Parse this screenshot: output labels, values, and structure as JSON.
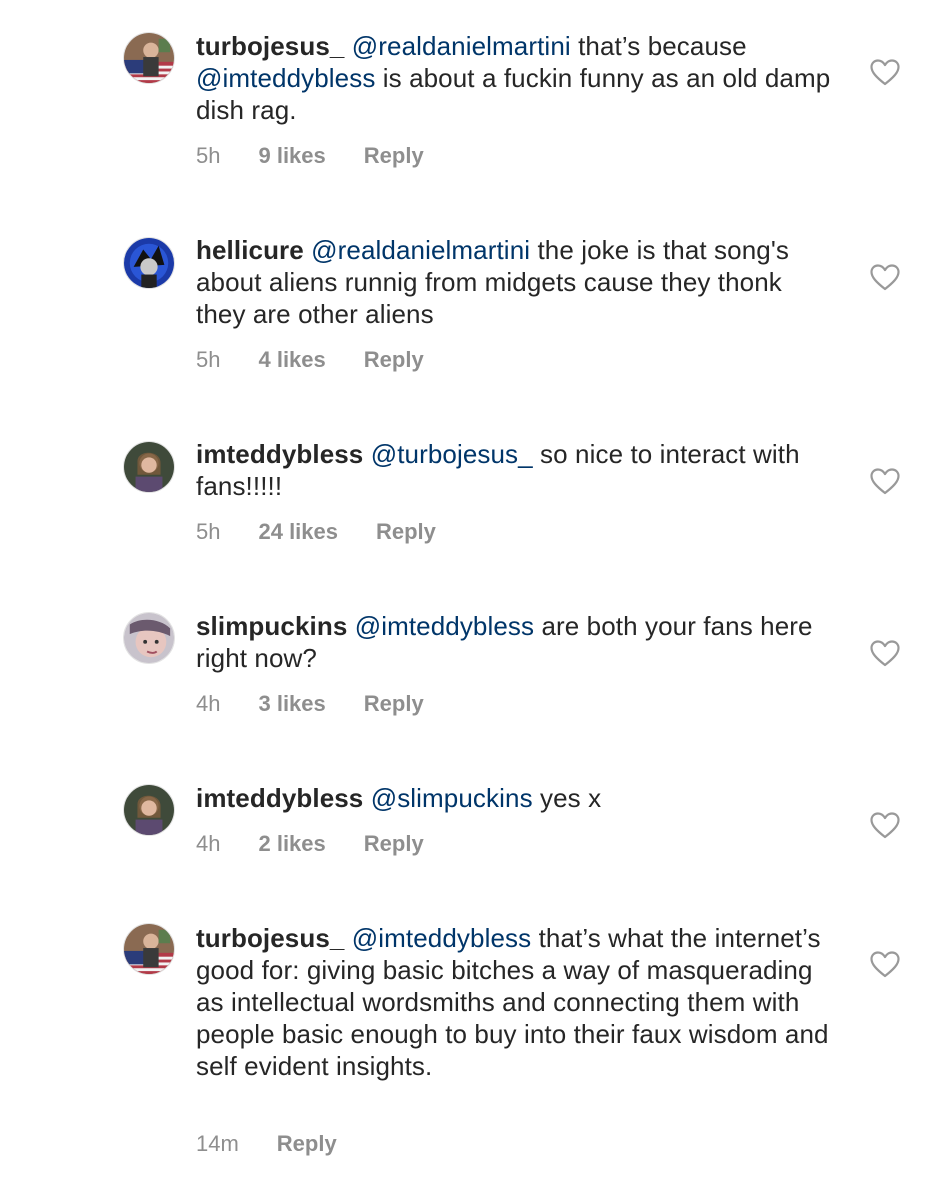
{
  "comments": [
    {
      "username": "turbojesus_",
      "mention": "@realdanielmartini",
      "text": "that’s because",
      "mention2": "@imteddybless",
      "text2": "is about a fuckin funny as an old damp dish rag.",
      "time": "5h",
      "likes": "9 likes",
      "reply": "Reply",
      "avatar_icon": "profile-avatar-flag"
    },
    {
      "username": "hellicure",
      "mention": "@realdanielmartini",
      "text": "the joke is that song's about aliens runnig from midgets cause they thonk they are other aliens",
      "time": "5h",
      "likes": "4 likes",
      "reply": "Reply",
      "avatar_icon": "profile-avatar-blue"
    },
    {
      "username": "imteddybless",
      "mention": "@turbojesus_",
      "text": "so nice to interact with fans!!!!!",
      "time": "5h",
      "likes": "24 likes",
      "reply": "Reply",
      "avatar_icon": "profile-avatar-photo"
    },
    {
      "username": "slimpuckins",
      "mention": "@imteddybless",
      "text": "are both your fans here right now?",
      "time": "4h",
      "likes": "3 likes",
      "reply": "Reply",
      "avatar_icon": "profile-avatar-face"
    },
    {
      "username": "imteddybless",
      "mention": "@slimpuckins",
      "text": "yes x",
      "time": "4h",
      "likes": "2 likes",
      "reply": "Reply",
      "avatar_icon": "profile-avatar-photo"
    },
    {
      "username": "turbojesus_",
      "mention": "@imteddybless",
      "text": "that’s what the internet’s good for: giving basic bitches a way of masquerading as intellectual wordsmiths and connecting them with people basic enough to buy into their faux wisdom and self evident insights.",
      "time": "14m",
      "reply": "Reply",
      "avatar_icon": "profile-avatar-flag"
    }
  ],
  "colors": {
    "text": "#262626",
    "mention": "#003569",
    "meta": "#8e8e8e",
    "heart_stroke": "#999999"
  },
  "icons": {
    "like": "heart-outline-icon"
  }
}
